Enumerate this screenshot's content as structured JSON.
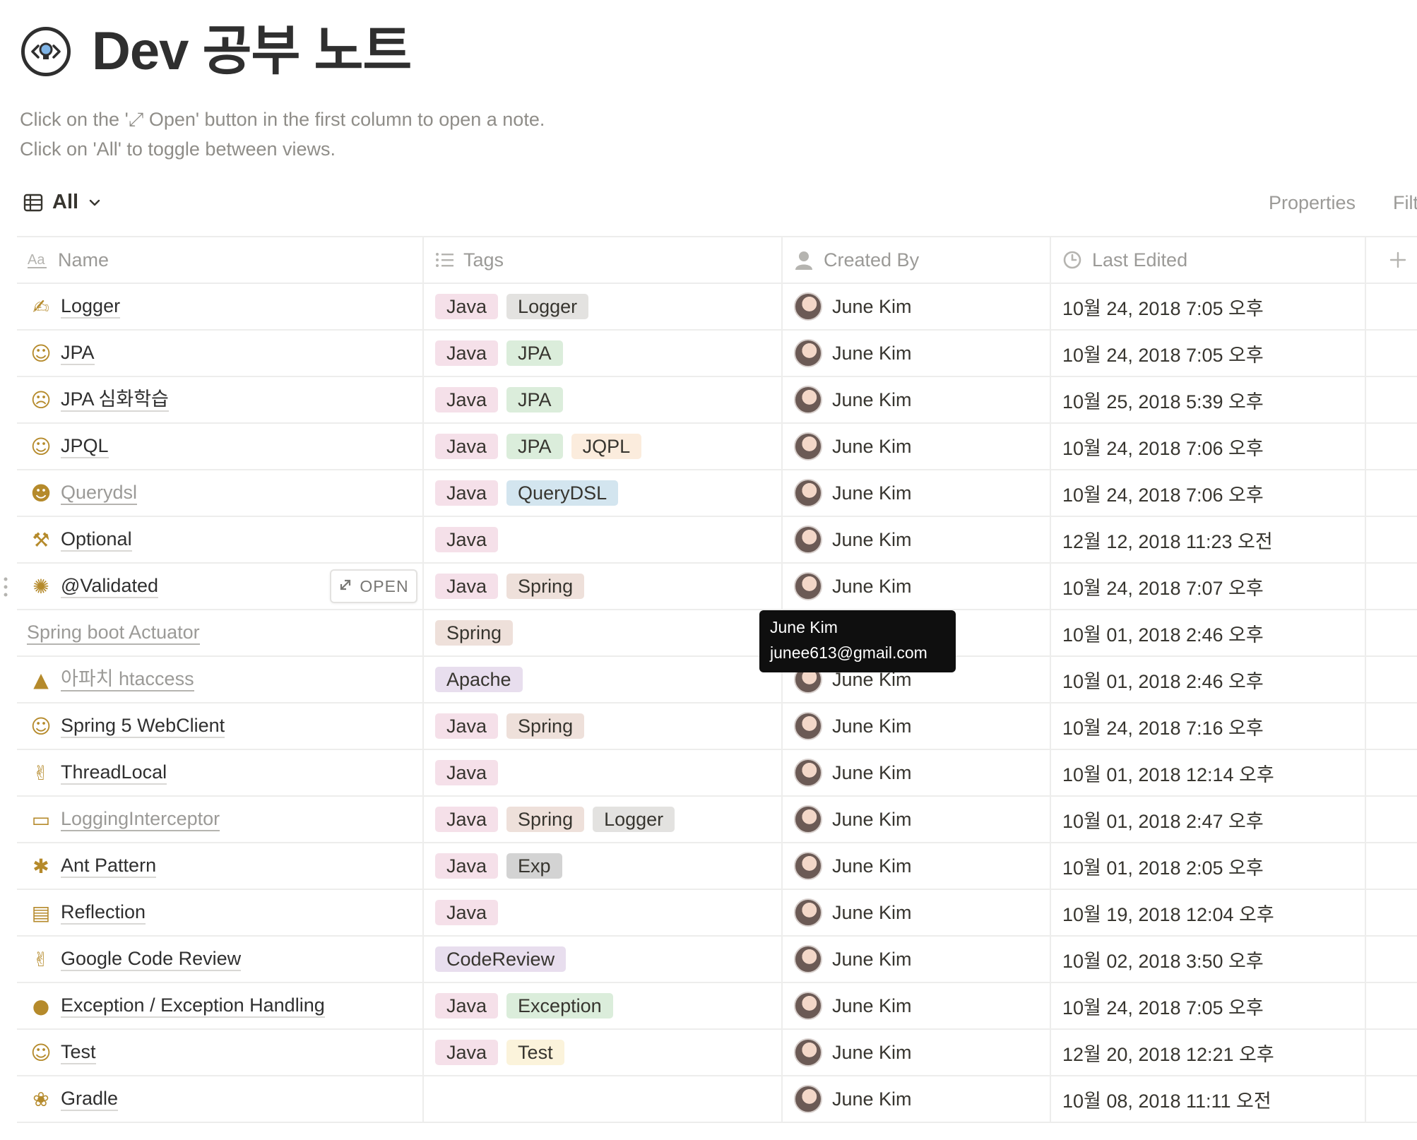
{
  "page": {
    "title": "Dev 공부 노트",
    "description": [
      "Click on the '⤢ Open' button in the first column to open a note.",
      "Click on 'All' to toggle between views."
    ],
    "view_label": "All",
    "properties_label": "Properties",
    "filter_label": "Filt"
  },
  "columns": {
    "name": "Name",
    "tags": "Tags",
    "created_by": "Created By",
    "last_edited": "Last Edited"
  },
  "tag_colors": {
    "Java": "#f5e0e9",
    "Logger": "#e3e2e0",
    "JPA": "#dbeddb",
    "JQPL": "#fbecdd",
    "QueryDSL": "#d3e5ef",
    "Spring": "#eee0da",
    "Apache": "#e8deee",
    "Exp": "#d3d3d3",
    "CodeReview": "#e8deee",
    "Exception": "#dbeddb",
    "Test": "#fbf3db"
  },
  "open_button_label": "OPEN",
  "tooltip": {
    "name": "June Kim",
    "email": "junee613@gmail.com"
  },
  "rows": [
    {
      "emoji": "✍",
      "name": "Logger",
      "link": false,
      "tags": [
        "Java",
        "Logger"
      ],
      "created_by": "June Kim",
      "last_edited": "10월 24, 2018 7:05 오후"
    },
    {
      "emoji": "☺",
      "name": "JPA",
      "link": false,
      "tags": [
        "Java",
        "JPA"
      ],
      "created_by": "June Kim",
      "last_edited": "10월 24, 2018 7:05 오후"
    },
    {
      "emoji": "☹",
      "name": "JPA 심화학습",
      "link": false,
      "tags": [
        "Java",
        "JPA"
      ],
      "created_by": "June Kim",
      "last_edited": "10월 25, 2018 5:39 오후"
    },
    {
      "emoji": "☺",
      "name": "JPQL",
      "link": false,
      "tags": [
        "Java",
        "JPA",
        "JQPL"
      ],
      "created_by": "June Kim",
      "last_edited": "10월 24, 2018 7:06 오후"
    },
    {
      "emoji": "☻",
      "name": "Querydsl",
      "link": true,
      "tags": [
        "Java",
        "QueryDSL"
      ],
      "created_by": "June Kim",
      "last_edited": "10월 24, 2018 7:06 오후"
    },
    {
      "emoji": "⚒",
      "name": "Optional",
      "link": false,
      "tags": [
        "Java"
      ],
      "created_by": "June Kim",
      "last_edited": "12월 12, 2018 11:23 오전"
    },
    {
      "emoji": "✺",
      "name": "@Validated",
      "link": false,
      "tags": [
        "Java",
        "Spring"
      ],
      "created_by": "June Kim",
      "last_edited": "10월 24, 2018 7:07 오후",
      "hovered": true
    },
    {
      "emoji": "",
      "name": "Spring boot Actuator",
      "link": true,
      "tags": [
        "Spring"
      ],
      "created_by": "June Kim",
      "last_edited": "10월 01, 2018 2:46 오후"
    },
    {
      "emoji": "▲",
      "name": "아파치 htaccess",
      "link": true,
      "tags": [
        "Apache"
      ],
      "created_by": "June Kim",
      "last_edited": "10월 01, 2018 2:46 오후"
    },
    {
      "emoji": "☺",
      "name": "Spring 5 WebClient",
      "link": false,
      "tags": [
        "Java",
        "Spring"
      ],
      "created_by": "June Kim",
      "last_edited": "10월 24, 2018 7:16 오후"
    },
    {
      "emoji": "✌",
      "name": "ThreadLocal",
      "link": false,
      "tags": [
        "Java"
      ],
      "created_by": "June Kim",
      "last_edited": "10월 01, 2018 12:14 오후"
    },
    {
      "emoji": "▭",
      "name": "LoggingInterceptor",
      "link": true,
      "tags": [
        "Java",
        "Spring",
        "Logger"
      ],
      "created_by": "June Kim",
      "last_edited": "10월 01, 2018 2:47 오후"
    },
    {
      "emoji": "✱",
      "name": "Ant Pattern",
      "link": false,
      "tags": [
        "Java",
        "Exp"
      ],
      "created_by": "June Kim",
      "last_edited": "10월 01, 2018 2:05 오후"
    },
    {
      "emoji": "▤",
      "name": "Reflection",
      "link": false,
      "tags": [
        "Java"
      ],
      "created_by": "June Kim",
      "last_edited": "10월 19, 2018 12:04 오후"
    },
    {
      "emoji": "✌",
      "name": "Google Code Review",
      "link": false,
      "tags": [
        "CodeReview"
      ],
      "created_by": "June Kim",
      "last_edited": "10월 02, 2018 3:50 오후"
    },
    {
      "emoji": "●",
      "name": "Exception / Exception Handling",
      "link": false,
      "tags": [
        "Java",
        "Exception"
      ],
      "created_by": "June Kim",
      "last_edited": "10월 24, 2018 7:05 오후"
    },
    {
      "emoji": "☺",
      "name": "Test",
      "link": false,
      "tags": [
        "Java",
        "Test"
      ],
      "created_by": "June Kim",
      "last_edited": "12월 20, 2018 12:21 오후"
    },
    {
      "emoji": "❀",
      "name": "Gradle",
      "link": false,
      "tags": [],
      "created_by": "June Kim",
      "last_edited": "10월 08, 2018 11:11 오전"
    }
  ]
}
